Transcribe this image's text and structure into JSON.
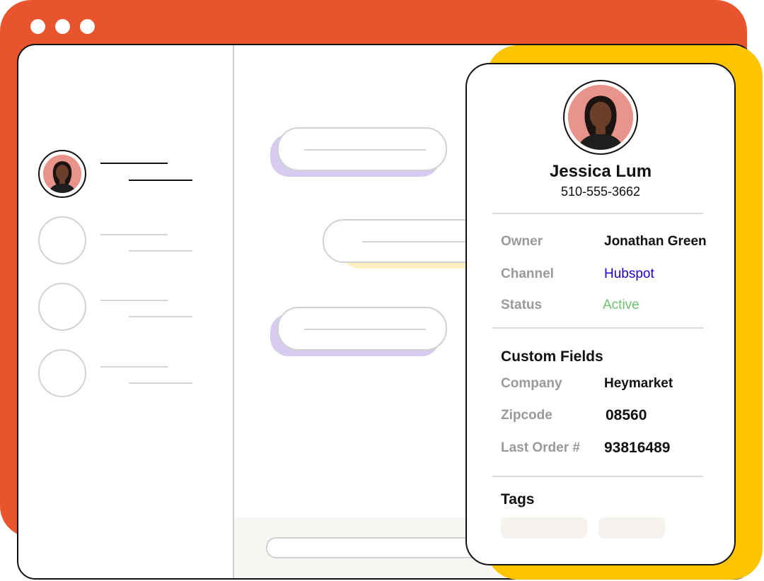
{
  "colors": {
    "brand_orange": "#E8542E",
    "accent_yellow": "#FFC400",
    "channel_link": "#1F00C8",
    "status_active": "#6CC26E",
    "bubble_shadow_purple": "#D5CCEF",
    "bubble_shadow_yellow": "#FFF0C2"
  },
  "window_controls": [
    "dot",
    "dot",
    "dot"
  ],
  "contact_card": {
    "name": "Jessica Lum",
    "phone": "510-555-3662",
    "details": [
      {
        "label": "Owner",
        "value": "Jonathan Green"
      },
      {
        "label": "Channel",
        "value": "Hubspot"
      },
      {
        "label": "Status",
        "value": "Active"
      }
    ],
    "custom_fields_title": "Custom Fields",
    "custom_fields": [
      {
        "label": "Company",
        "value": "Heymarket"
      },
      {
        "label": "Zipcode",
        "value": "08560"
      },
      {
        "label": "Last Order #",
        "value": "93816489"
      }
    ],
    "tags_title": "Tags"
  },
  "avatar_icon": "person-avatar-icon"
}
